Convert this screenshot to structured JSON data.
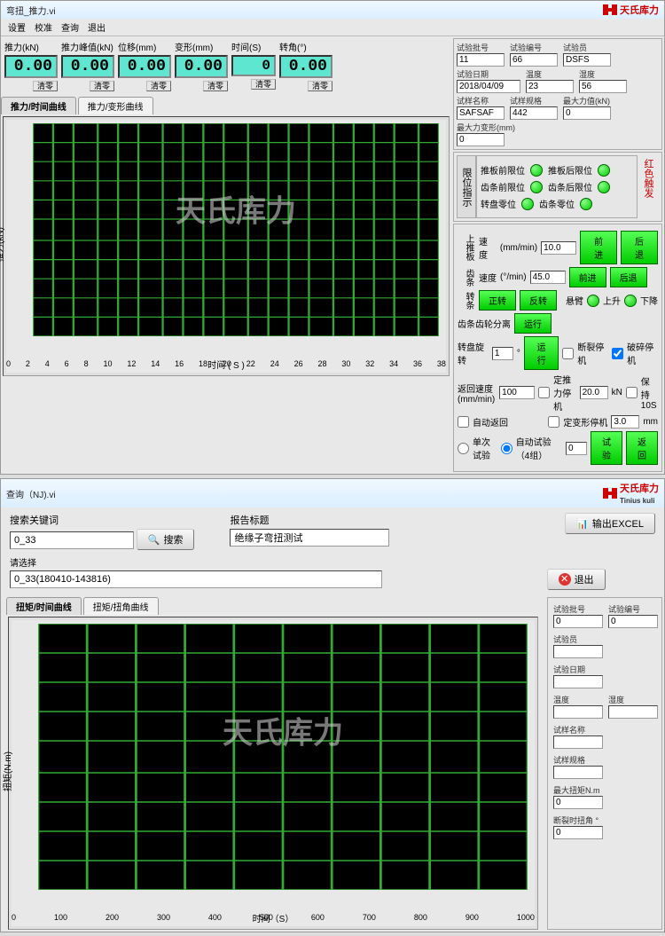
{
  "brand": {
    "name_cn": "天氏库力",
    "name_en": "Tinius kuli",
    "watermark": "天氏库力"
  },
  "top_window": {
    "title": "弯扭_推力.vi",
    "menu": [
      "设置",
      "校准",
      "查询",
      "退出"
    ],
    "lcd": [
      {
        "label": "推力(kN)",
        "value": "0.00",
        "clear": "清零"
      },
      {
        "label": "推力峰值(kN)",
        "value": "0.00",
        "clear": "清零"
      },
      {
        "label": "位移(mm)",
        "value": "0.00",
        "clear": "清零"
      },
      {
        "label": "变形(mm)",
        "value": "0.00",
        "clear": "清零"
      },
      {
        "label": "时间(S)",
        "value": "0",
        "clear": "清零"
      },
      {
        "label": "转角(°)",
        "value": "0.00",
        "clear": "清零"
      }
    ],
    "tabs": [
      "推力/时间曲线",
      "推力/变形曲线"
    ],
    "chart": {
      "ylabel": "推力(kN)",
      "xlabel": "时间 ( S )"
    },
    "info": {
      "batch_lbl": "试验批号",
      "batch": "11",
      "no_lbl": "试验编号",
      "no": "66",
      "tester_lbl": "试验员",
      "tester": "DSFS",
      "date_lbl": "试验日期",
      "date": "2018/04/09",
      "temp_lbl": "温度",
      "temp": "23",
      "humid_lbl": "湿度",
      "humid": "56",
      "name_lbl": "试样名称",
      "name": "SAFSAF",
      "spec_lbl": "试样规格",
      "spec": "442",
      "maxf_lbl": "最大力值(kN)",
      "maxf": "0",
      "maxd_lbl": "最大力变形(mm)",
      "maxd": "0"
    },
    "limits": {
      "header": "限位指示",
      "rows": [
        [
          "推板前限位",
          "推板后限位"
        ],
        [
          "齿条前限位",
          "齿条后限位"
        ],
        [
          "转盘零位",
          "齿条零位"
        ]
      ],
      "alarm": "红色触发"
    },
    "motion": {
      "grp1": {
        "lbl": "上推板",
        "speed_lbl": "速度",
        "unit": "(mm/min)",
        "val": "10.0",
        "fwd": "前进",
        "back": "后退"
      },
      "grp2": {
        "lbl": "齿条",
        "speed_lbl": "速度",
        "unit": "(°/min)",
        "val": "45.0",
        "fwd": "前进",
        "back": "后退"
      },
      "grp3": {
        "lbl": "转条",
        "cw": "正转",
        "ccw": "反转",
        "pause": "悬臂",
        "up": "上升",
        "down": "下降"
      },
      "sep": {
        "lbl": "齿条齿轮分离",
        "btn": "运行"
      },
      "rot": {
        "lbl": "转盘旋转",
        "val": "1",
        "unit": "°",
        "btn": "运行"
      },
      "stop1_lbl": "断裂停机",
      "stop1_chk": "破碎停机",
      "stop2_lbl": "定推力停机",
      "stop2_val": "20.0",
      "stop2_unit": "kN",
      "stop2_chk": "保持10S",
      "stop3_lbl": "定变形停机",
      "stop3_val": "3.0",
      "stop3_unit": "mm",
      "ret_lbl": "返回速度 (mm/min)",
      "ret_val": "100",
      "autoret": "自动返回",
      "mode_single": "单次试验",
      "mode_auto": "自动试验（4组）",
      "auto_val": "0",
      "btn_test": "试验",
      "btn_back": "返回"
    }
  },
  "bottom_window": {
    "title": "查询（NJ).vi",
    "search": {
      "kw_lbl": "搜索关键词",
      "kw_val": "0_33",
      "btn": "搜索",
      "title_lbl": "报告标题",
      "title_val": "绝缘子弯扭测试",
      "sel_lbl": "请选择",
      "sel_val": "0_33(180410-143816)",
      "excel": "输出EXCEL",
      "exit": "退出"
    },
    "tabs": [
      "扭矩/时间曲线",
      "扭矩/扭角曲线"
    ],
    "chart": {
      "ylabel": "扭矩(N.m)",
      "xlabel": "时间（S）"
    },
    "side": {
      "batch_lbl": "试验批号",
      "batch": "0",
      "no_lbl": "试验编号",
      "no": "0",
      "tester_lbl": "试验员",
      "tester": "",
      "date_lbl": "试验日期",
      "date": "",
      "temp_lbl": "温度",
      "temp": "",
      "humid_lbl": "湿度",
      "humid": "",
      "name_lbl": "试样名称",
      "name": "",
      "spec_lbl": "试样规格",
      "spec": "",
      "maxt_lbl": "最大扭矩N.m",
      "maxt": "0",
      "ang_lbl": "断裂时扭角 °",
      "ang": "0"
    }
  },
  "chart_data": [
    {
      "type": "line",
      "title": "推力/时间曲线",
      "xlabel": "时间(S)",
      "ylabel": "推力(kN)",
      "xlim": [
        0,
        38
      ],
      "ylim": [
        0,
        22
      ],
      "x_ticks": [
        0,
        2,
        4,
        6,
        8,
        10,
        12,
        14,
        16,
        18,
        20,
        22,
        24,
        26,
        28,
        30,
        32,
        34,
        36,
        38
      ],
      "y_ticks": [
        0,
        2,
        4,
        6,
        8,
        10,
        12,
        14,
        16,
        18,
        20,
        22
      ],
      "series": [
        {
          "name": "推力",
          "x": [],
          "y": []
        }
      ]
    },
    {
      "type": "line",
      "title": "扭矩/时间曲线",
      "xlabel": "时间(S)",
      "ylabel": "扭矩(N.m)",
      "xlim": [
        0,
        1000
      ],
      "ylim": [
        0,
        9
      ],
      "x_ticks": [
        0,
        100,
        200,
        300,
        400,
        500,
        600,
        700,
        800,
        900,
        1000
      ],
      "y_ticks": [
        0,
        1,
        2,
        3,
        4,
        5,
        6,
        7,
        8,
        9
      ],
      "series": [
        {
          "name": "扭矩",
          "x": [],
          "y": []
        }
      ]
    }
  ]
}
